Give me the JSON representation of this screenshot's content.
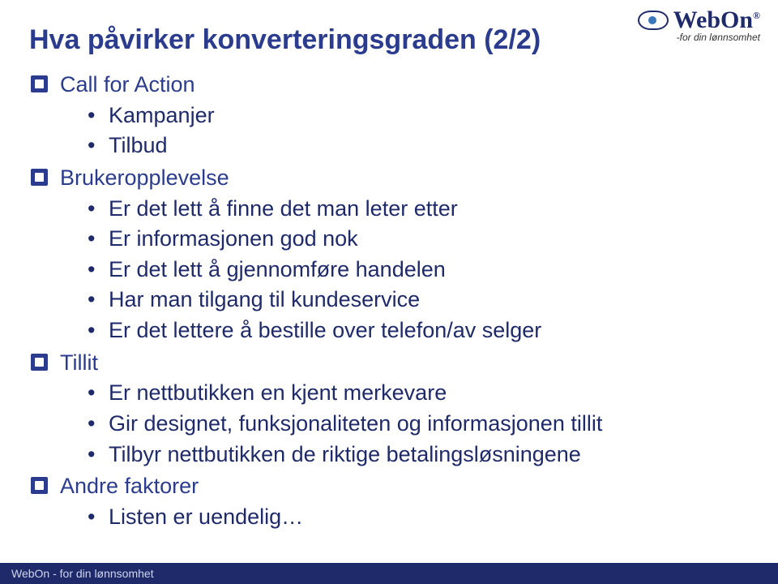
{
  "title": "Hva påvirker konverteringsgraden (2/2)",
  "bullets": [
    {
      "label": "Call for Action",
      "sub": [
        "Kampanjer",
        "Tilbud"
      ]
    },
    {
      "label": "Brukeropplevelse",
      "sub": [
        "Er det lett å finne det man leter etter",
        "Er informasjonen god nok",
        "Er det lett å gjennomføre handelen",
        "Har man tilgang til kundeservice",
        "Er det lettere å bestille over telefon/av  selger"
      ]
    },
    {
      "label": "Tillit",
      "sub": [
        "Er nettbutikken en kjent merkevare",
        "Gir designet, funksjonaliteten og informasjonen tillit",
        "Tilbyr nettbutikken de riktige betalingsløsningene"
      ]
    },
    {
      "label": "Andre faktorer",
      "sub": [
        "Listen er uendelig…"
      ]
    }
  ],
  "logo": {
    "name": "WebOn",
    "reg": "®",
    "tagline": "-for din lønnsomhet"
  },
  "footer": "WebOn  - for din lønnsomhet"
}
